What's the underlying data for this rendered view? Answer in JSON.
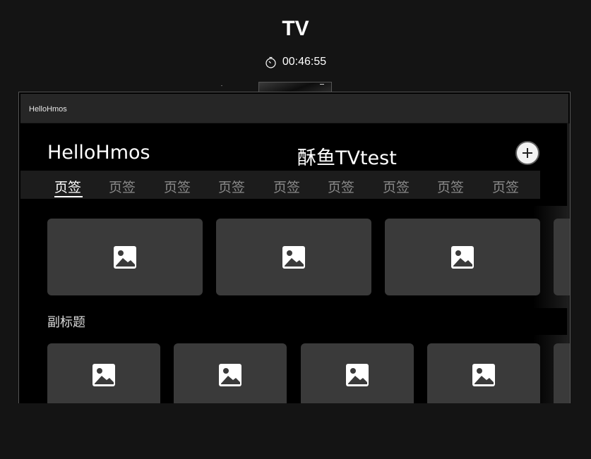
{
  "device": {
    "title": "TV",
    "timer": "00:46:55",
    "timer_icon": "stopwatch-icon"
  },
  "window": {
    "title": "HelloHmos"
  },
  "header": {
    "title": "HelloHmos",
    "center_title": "酥鱼TVtest",
    "add_icon": "plus-circle-icon"
  },
  "tabs": [
    {
      "label": "页签",
      "active": true
    },
    {
      "label": "页签",
      "active": false
    },
    {
      "label": "页签",
      "active": false
    },
    {
      "label": "页签",
      "active": false
    },
    {
      "label": "页签",
      "active": false
    },
    {
      "label": "页签",
      "active": false
    },
    {
      "label": "页签",
      "active": false
    },
    {
      "label": "页签",
      "active": false
    },
    {
      "label": "页签",
      "active": false
    }
  ],
  "section": {
    "subtitle": "副标题"
  },
  "cards": {
    "image_icon": "image-placeholder-icon",
    "color": "#3a3a3a"
  }
}
